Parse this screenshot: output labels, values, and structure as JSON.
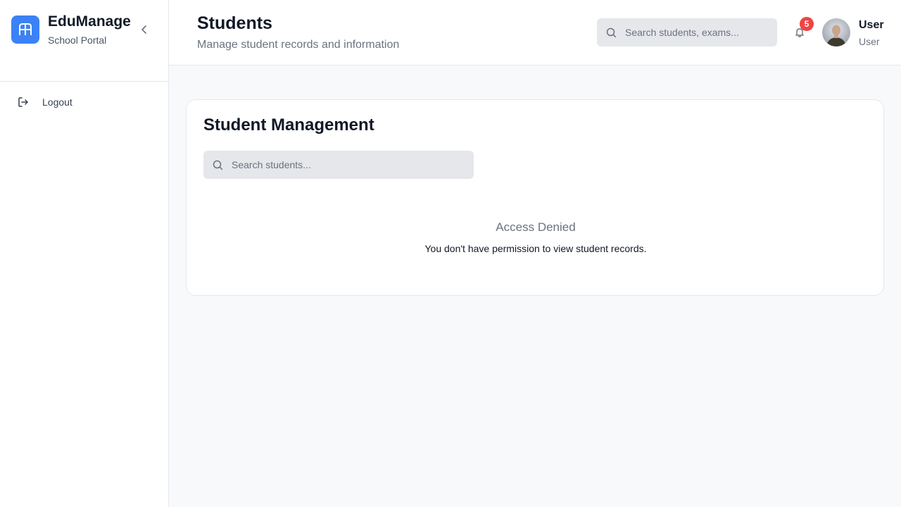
{
  "brand": {
    "title": "EduManage",
    "subtitle": "School Portal",
    "logo_icon": "building-columns-icon",
    "accent": "#3b82f6"
  },
  "sidebar": {
    "items": [
      {
        "label": "Logout",
        "icon": "logout-icon"
      }
    ]
  },
  "header": {
    "title": "Students",
    "subtitle": "Manage student records and information",
    "search_placeholder": "Search students, exams...",
    "notifications_count": "5",
    "user": {
      "name": "User",
      "role": "User"
    }
  },
  "card": {
    "title": "Student Management",
    "search_placeholder": "Search students...",
    "denied_title": "Access Denied",
    "denied_message": "You don't have permission to view student records."
  },
  "colors": {
    "badge": "#ef4444",
    "input_bg": "#e5e7eb",
    "page_bg": "#f8f9fb"
  }
}
